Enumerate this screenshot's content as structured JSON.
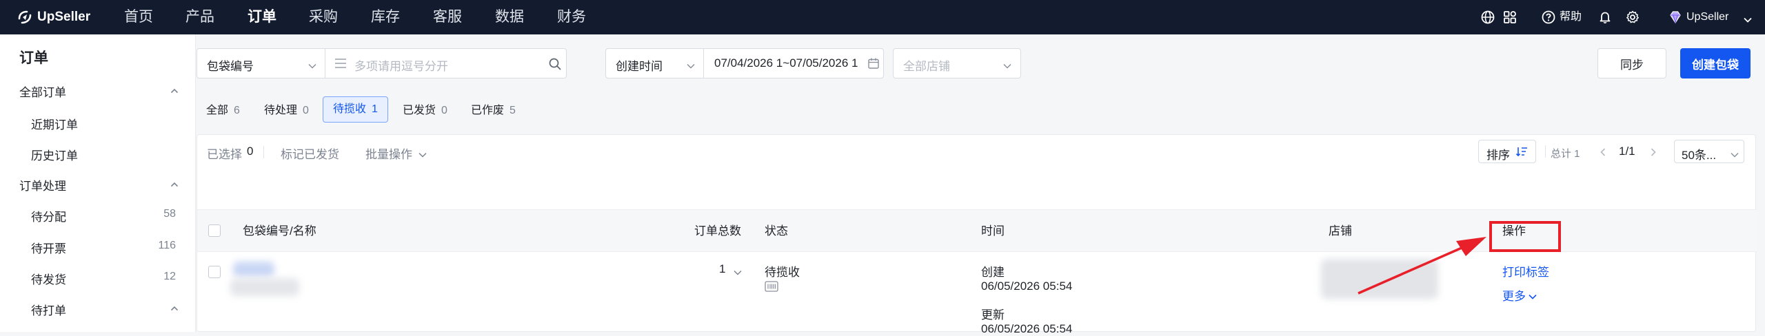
{
  "topnav": {
    "logo": "UpSeller",
    "items": [
      {
        "label": "首页"
      },
      {
        "label": "产品"
      },
      {
        "label": "订单"
      },
      {
        "label": "采购"
      },
      {
        "label": "库存"
      },
      {
        "label": "客服"
      },
      {
        "label": "数据"
      },
      {
        "label": "财务"
      }
    ],
    "active": "订单",
    "help": "帮助",
    "account": "UpSeller"
  },
  "sidebar": {
    "title": "订单",
    "groups": [
      {
        "label": "全部订单",
        "items": [
          {
            "label": "近期订单"
          },
          {
            "label": "历史订单"
          }
        ]
      },
      {
        "label": "订单处理",
        "items": [
          {
            "label": "待分配",
            "count": "58"
          },
          {
            "label": "待开票",
            "count": "116"
          },
          {
            "label": "待发货",
            "count": "12"
          },
          {
            "label": "待打单",
            "count": ""
          }
        ]
      }
    ]
  },
  "filters": {
    "search_type": "包袋编号",
    "search_placeholder": "多项请用逗号分开",
    "time_type": "创建时间",
    "date_range": "07/04/2026 1~07/05/2026 1",
    "store_placeholder": "全部店铺"
  },
  "actions": {
    "sync": "同步",
    "create": "创建包袋"
  },
  "tabs": [
    {
      "label": "全部",
      "count": "6"
    },
    {
      "label": "待处理",
      "count": "0"
    },
    {
      "label": "待揽收",
      "count": "1"
    },
    {
      "label": "已发货",
      "count": "0"
    },
    {
      "label": "已作废",
      "count": "5"
    }
  ],
  "active_tab": "待揽收",
  "toolbar": {
    "selected_label": "已选择",
    "selected_count": "0",
    "mark_shipped": "标记已发货",
    "batch": "批量操作",
    "sort": "排序",
    "total": "总计 1",
    "page": "1/1",
    "page_size": "50条..."
  },
  "table": {
    "columns": {
      "bag": "包袋编号/名称",
      "total": "订单总数",
      "status": "状态",
      "time": "时间",
      "store": "店铺",
      "ops": "操作"
    },
    "rows": [
      {
        "order_total": "1",
        "status": "待揽收",
        "created_label": "创建",
        "created": "06/05/2026 05:54",
        "updated_label": "更新",
        "updated": "06/05/2026 05:54",
        "print": "打印标签",
        "more": "更多"
      }
    ]
  },
  "colors": {
    "primary": "#1456f0",
    "nav_bg": "#131b2f",
    "annotation": "#e8202a"
  }
}
